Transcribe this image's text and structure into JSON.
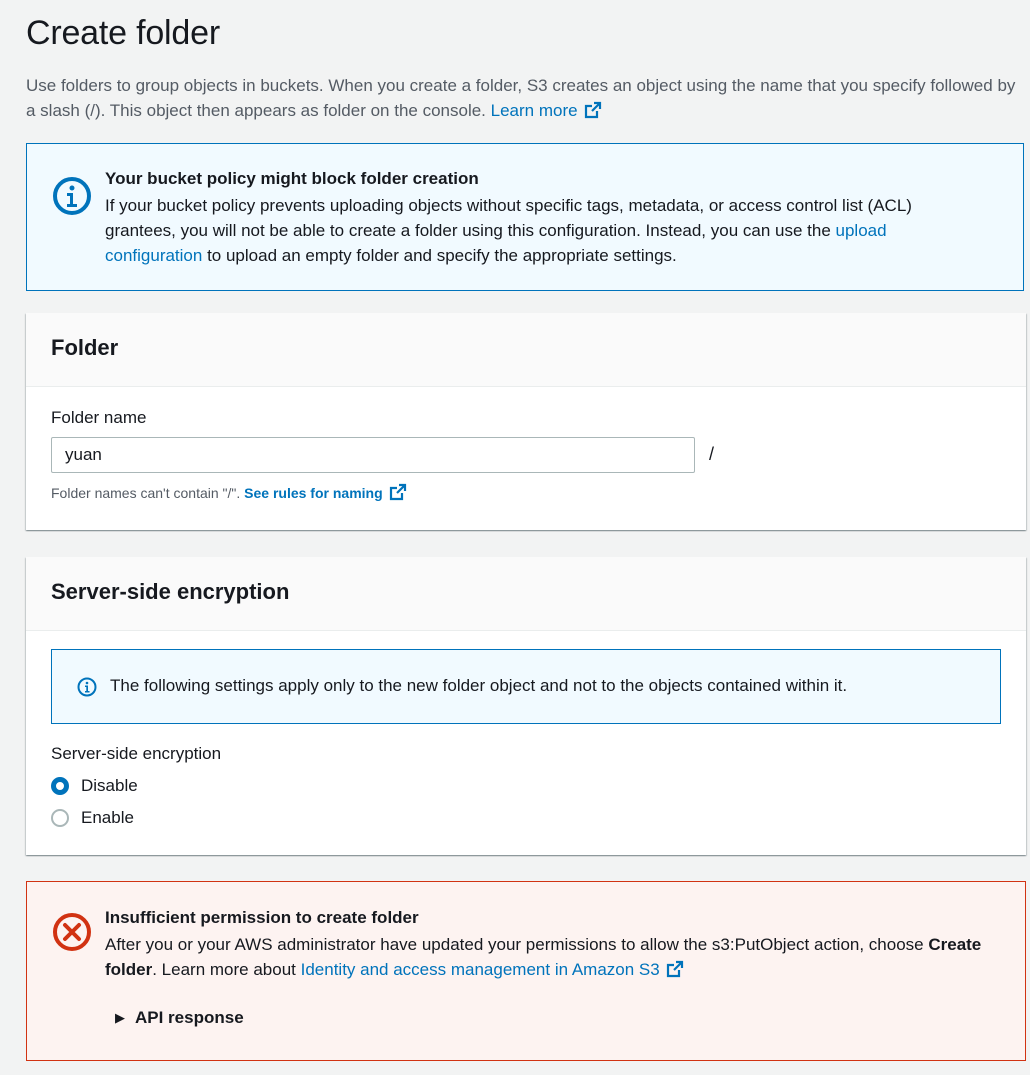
{
  "page": {
    "title": "Create folder",
    "description": "Use folders to group objects in buckets. When you create a folder, S3 creates an object using the name that you specify followed by a slash (/). This object then appears as folder on the console.",
    "learn_more": "Learn more"
  },
  "policy_alert": {
    "title": "Your bucket policy might block folder creation",
    "body_before": "If your bucket policy prevents uploading objects without specific tags, metadata, or access control list (ACL) grantees, you will not be able to create a folder using this configuration. Instead, you can use the ",
    "link": "upload configuration",
    "body_after": " to upload an empty folder and specify the appropriate settings."
  },
  "folder": {
    "header": "Folder",
    "name_label": "Folder name",
    "name_value": "yuan",
    "slash": "/",
    "hint": "Folder names can't contain \"/\".",
    "hint_link": "See rules for naming"
  },
  "encryption": {
    "header": "Server-side encryption",
    "info": "The following settings apply only to the new folder object and not to the objects contained within it.",
    "label": "Server-side encryption",
    "options": [
      {
        "label": "Disable",
        "checked": true
      },
      {
        "label": "Enable",
        "checked": false
      }
    ]
  },
  "error_alert": {
    "title": "Insufficient permission to create folder",
    "body_before": "After you or your AWS administrator have updated your permissions to allow the s3:PutObject action, choose ",
    "body_bold": "Create folder",
    "body_middle": ". Learn more about ",
    "link": "Identity and access management in Amazon S3",
    "expander": "API response"
  },
  "colors": {
    "link": "#0073bb",
    "info_bg": "#f1faff",
    "error": "#d13212",
    "error_bg": "#fdf3f1"
  }
}
